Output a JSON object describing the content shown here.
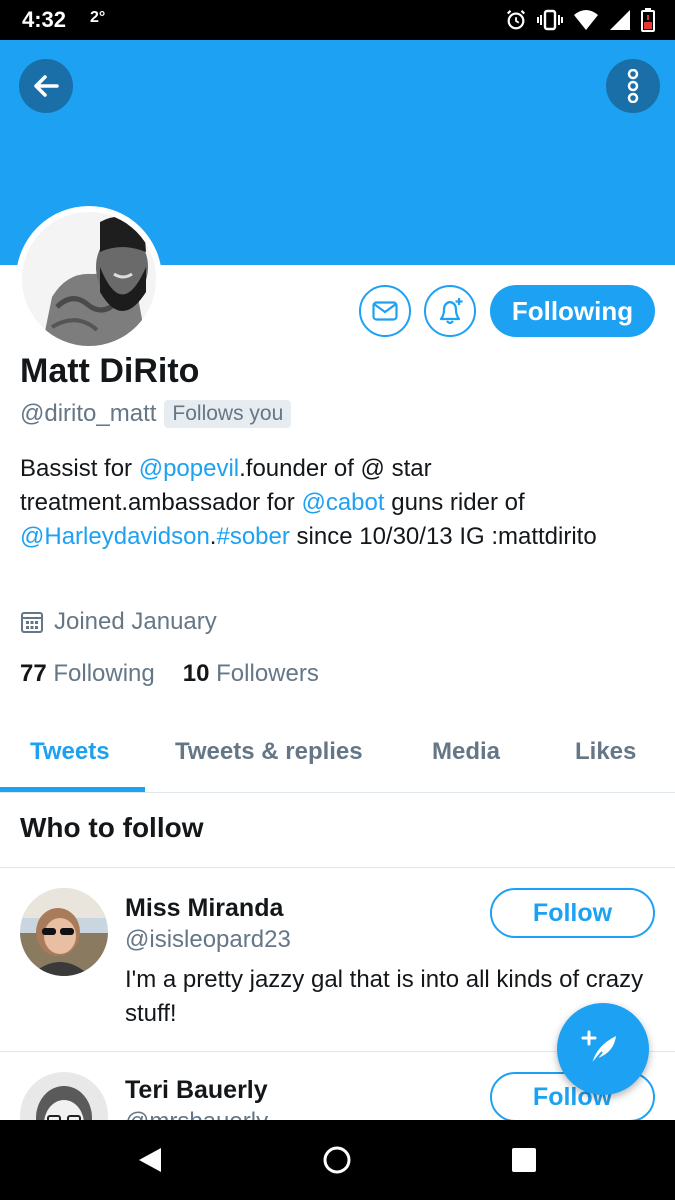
{
  "status_bar": {
    "time": "4:32",
    "temperature": "2°",
    "icons": [
      "alarm-icon",
      "vibrate-icon",
      "wifi-icon",
      "signal-icon",
      "battery-low-icon"
    ]
  },
  "colors": {
    "brand": "#1da1f2",
    "banner": "#1da1f2",
    "text_primary": "#14171a",
    "text_secondary": "#657786"
  },
  "header": {
    "back_icon": "arrow-left-icon",
    "more_icon": "more-vertical-icon"
  },
  "profile": {
    "name": "Matt DiRito",
    "handle": "@dirito_matt",
    "follows_you": "Follows you",
    "bio": {
      "t1": "Bassist for ",
      "l1": "@popevil",
      "t2": ".founder of @ star treatment.ambassador for ",
      "l2": "@cabot",
      "t3": " guns rider of ",
      "l3": "@Harleydavidson",
      "t4": ".",
      "l4": "#sober",
      "t5": " since 10/30/13 IG :mattdirito"
    },
    "joined": "Joined January",
    "following_count": "77",
    "following_label": "Following",
    "followers_count": "10",
    "followers_label": "Followers"
  },
  "actions": {
    "following_label": "Following"
  },
  "tabs": [
    {
      "label": "Tweets",
      "active": true
    },
    {
      "label": "Tweets & replies",
      "active": false
    },
    {
      "label": "Media",
      "active": false
    },
    {
      "label": "Likes",
      "active": false
    }
  ],
  "who_to_follow": {
    "title": "Who to follow",
    "items": [
      {
        "name": "Miss Miranda",
        "handle": "@isisleopard23",
        "bio": "I'm a pretty jazzy gal that is into all kinds of crazy stuff!",
        "button": "Follow"
      },
      {
        "name": "Teri Bauerly",
        "handle": "@mrsbauerly",
        "button": "Follow"
      }
    ]
  },
  "fab": {
    "icon": "compose-tweet-icon"
  },
  "nav": {
    "icons": [
      "back-triangle-icon",
      "home-circle-icon",
      "recents-square-icon"
    ]
  }
}
